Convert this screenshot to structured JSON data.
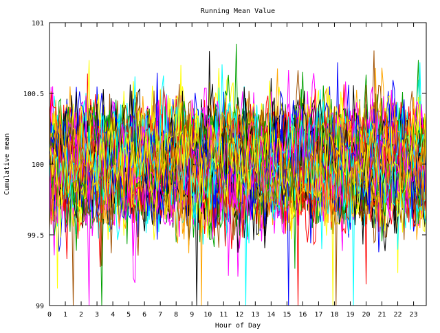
{
  "chart_data": {
    "type": "line",
    "title": "Running Mean Value",
    "xlabel": "Hour of Day",
    "ylabel": "Cumulative mean",
    "xlim": [
      0,
      23.8
    ],
    "ylim": [
      99,
      101
    ],
    "x_ticks": [
      "0",
      "1",
      "2",
      "3",
      "4",
      "5",
      "6",
      "7",
      "8",
      "9",
      "10",
      "11",
      "12",
      "13",
      "14",
      "15",
      "16",
      "17",
      "18",
      "19",
      "20",
      "21",
      "22",
      "23"
    ],
    "y_ticks": [
      "99",
      "99.5",
      "100",
      "100.5",
      "101"
    ],
    "grid": false,
    "legend": "none",
    "series_count": 80,
    "sample_step_hours": 0.1,
    "series_center": 100,
    "series_typical_range": [
      99.5,
      100.5
    ],
    "series_extremes": [
      {
        "x": 0.2,
        "y": 100.55
      },
      {
        "x": 11.8,
        "y": 100.85
      },
      {
        "x": 10.1,
        "y": 100.8
      },
      {
        "x": 20.6,
        "y": 100.68
      },
      {
        "x": 23.4,
        "y": 100.72
      },
      {
        "x": 18.2,
        "y": 100.72
      },
      {
        "x": 2.4,
        "y": 100.64
      },
      {
        "x": 0.5,
        "y": 99.12
      },
      {
        "x": 3.3,
        "y": 99.28
      },
      {
        "x": 11.3,
        "y": 99.21
      },
      {
        "x": 15.5,
        "y": 99.26
      },
      {
        "x": 20.0,
        "y": 99.15
      },
      {
        "x": 22.0,
        "y": 99.23
      },
      {
        "x": 1.5,
        "y": 99.0
      },
      {
        "x": 2.5,
        "y": 99.0
      },
      {
        "x": 3.25,
        "y": 99.0
      },
      {
        "x": 9.3,
        "y": 99.0
      },
      {
        "x": 9.6,
        "y": 99.0
      },
      {
        "x": 12.4,
        "y": 99.0
      },
      {
        "x": 15.1,
        "y": 99.0
      },
      {
        "x": 15.7,
        "y": 99.0
      },
      {
        "x": 17.9,
        "y": 99.0
      },
      {
        "x": 18.1,
        "y": 99.0
      },
      {
        "x": 19.2,
        "y": 99.0
      }
    ],
    "colors": [
      "#ff0000",
      "#00a000",
      "#0000ff",
      "#ff00ff",
      "#00ffff",
      "#a05000",
      "#ffa500",
      "#ffff00",
      "#000000"
    ]
  }
}
